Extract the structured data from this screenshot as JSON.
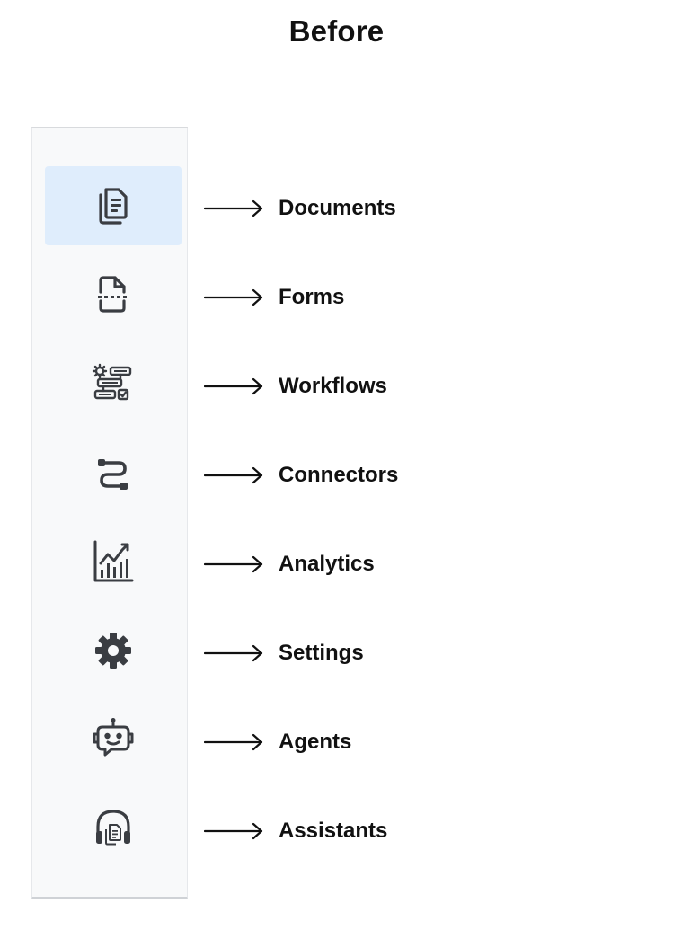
{
  "page_title": "Before",
  "sidebar": {
    "items": [
      {
        "key": "documents",
        "label": "Documents",
        "icon": "documents-icon",
        "active": true
      },
      {
        "key": "forms",
        "label": "Forms",
        "icon": "form-scan-icon"
      },
      {
        "key": "workflows",
        "label": "Workflows",
        "icon": "workflow-icon"
      },
      {
        "key": "connectors",
        "label": "Connectors",
        "icon": "connector-cable-icon"
      },
      {
        "key": "analytics",
        "label": "Analytics",
        "icon": "analytics-chart-icon"
      },
      {
        "key": "settings",
        "label": "Settings",
        "icon": "gear-icon"
      },
      {
        "key": "agents",
        "label": "Agents",
        "icon": "robot-icon"
      },
      {
        "key": "assistants",
        "label": "Assistants",
        "icon": "headset-document-icon"
      }
    ]
  },
  "colors": {
    "active_background": "#dfedfc",
    "icon": "#3a3d42",
    "text": "#111111"
  }
}
